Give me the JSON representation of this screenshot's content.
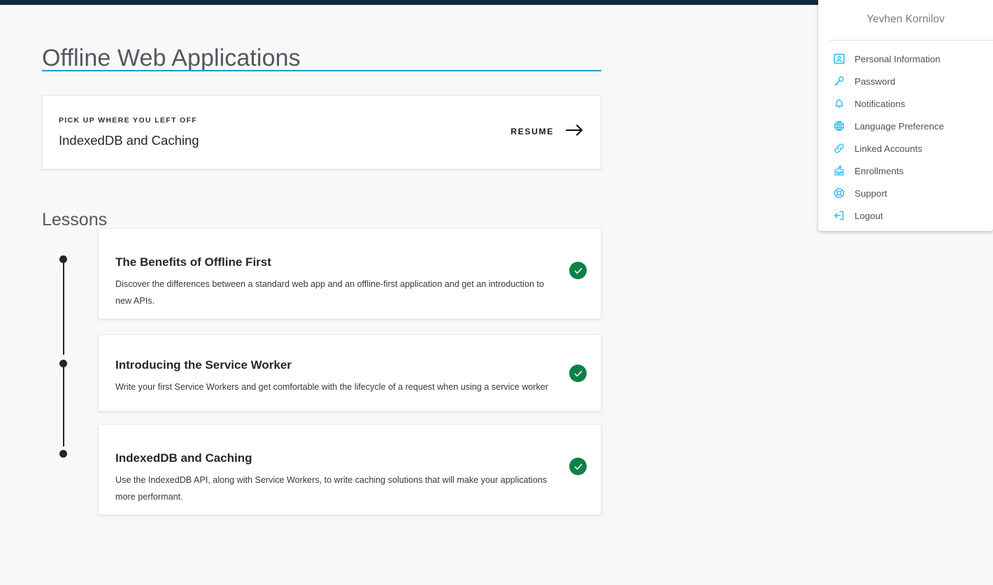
{
  "theme": {
    "accent": "#00a3cc",
    "topbar": "#0d2b3e",
    "icon_blue": "#25bbee",
    "complete_green": "#0e8048",
    "page_bg": "#f8f8f8",
    "card_bg": "#ffffff",
    "timeline": "#1d2733"
  },
  "page": {
    "title": "Offline Web Applications"
  },
  "resume": {
    "eyebrow": "PICK UP WHERE YOU LEFT OFF",
    "lesson_title": "IndexedDB and Caching",
    "action_label": "RESUME",
    "arrow_icon": "arrow-right-icon"
  },
  "lessons": {
    "heading": "Lessons",
    "items": [
      {
        "title": "The Benefits of Offline First",
        "description": "Discover the differences between a standard web app and an offline-first application and get an introduction to new APIs.",
        "status": "complete",
        "status_icon": "check-circle-icon"
      },
      {
        "title": "Introducing the Service Worker",
        "description": "Write your first Service Workers and get comfortable with the lifecycle of a request when using a service worker",
        "status": "complete",
        "status_icon": "check-circle-icon"
      },
      {
        "title": "IndexedDB and Caching",
        "description": "Use the IndexedDB API, along with Service Workers, to write caching solutions that will make your applications more performant.",
        "status": "complete",
        "status_icon": "check-circle-icon"
      }
    ]
  },
  "account_menu": {
    "user_name": "Yevhen Kornilov",
    "items": [
      {
        "label": "Personal Information",
        "icon": "id-card-icon"
      },
      {
        "label": "Password",
        "icon": "key-icon"
      },
      {
        "label": "Notifications",
        "icon": "bell-icon"
      },
      {
        "label": "Language Preference",
        "icon": "globe-icon"
      },
      {
        "label": "Linked Accounts",
        "icon": "link-icon"
      },
      {
        "label": "Enrollments",
        "icon": "school-icon"
      },
      {
        "label": "Support",
        "icon": "lifebuoy-icon"
      },
      {
        "label": "Logout",
        "icon": "logout-icon"
      }
    ]
  }
}
